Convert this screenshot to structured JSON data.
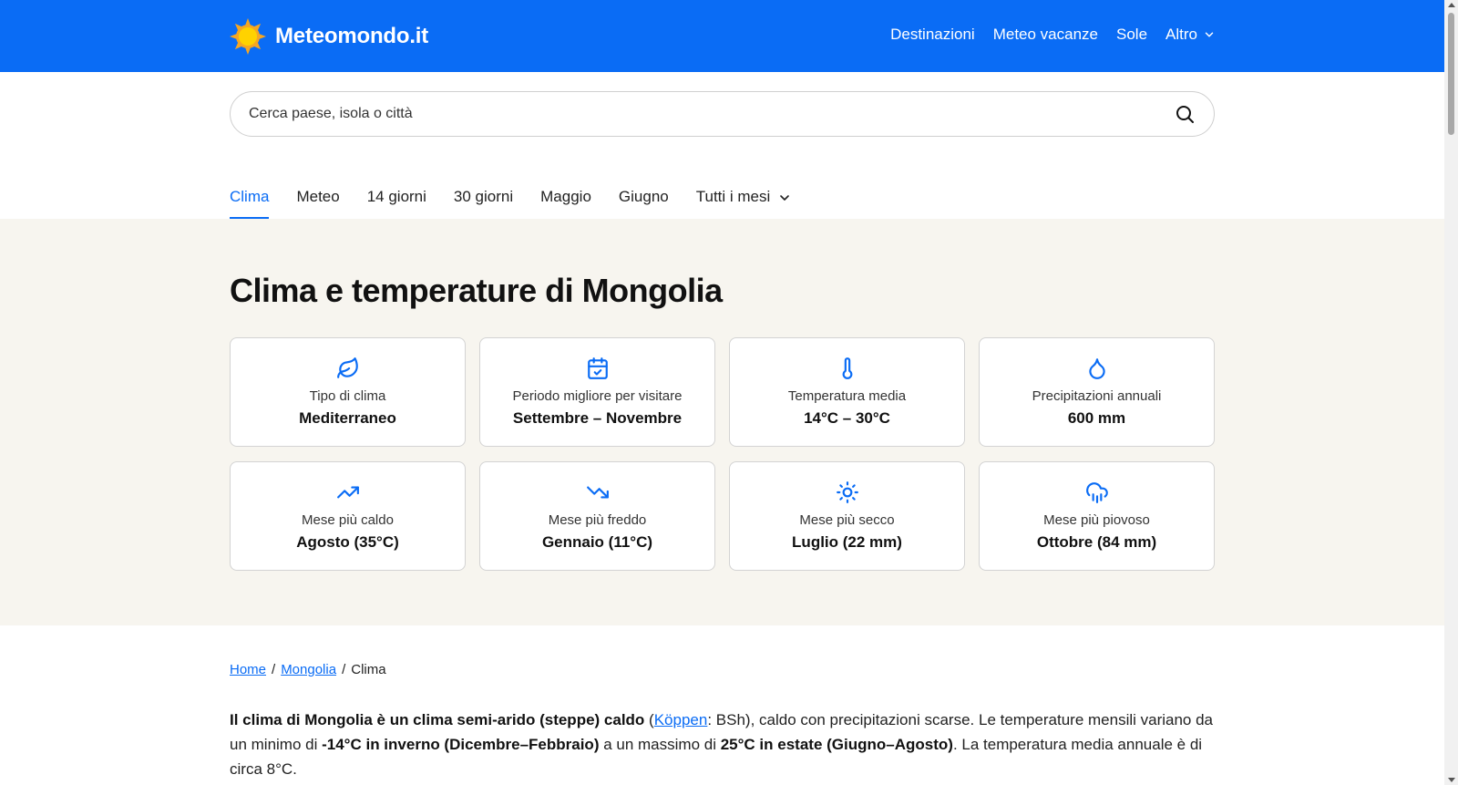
{
  "header": {
    "brand": "Meteomondo.it",
    "nav": [
      {
        "label": "Destinazioni"
      },
      {
        "label": "Meteo vacanze"
      },
      {
        "label": "Sole"
      },
      {
        "label": "Altro"
      }
    ]
  },
  "search": {
    "placeholder": "Cerca paese, isola o città"
  },
  "tabs": [
    {
      "label": "Clima"
    },
    {
      "label": "Meteo"
    },
    {
      "label": "14 giorni"
    },
    {
      "label": "30 giorni"
    },
    {
      "label": "Maggio"
    },
    {
      "label": "Giugno"
    },
    {
      "label": "Tutti i mesi"
    }
  ],
  "climate": {
    "title": "Clima e temperature di Mongolia",
    "cards": [
      {
        "icon": "leaf-icon",
        "label": "Tipo di clima",
        "value": "Mediterraneo"
      },
      {
        "icon": "calendar-check-icon",
        "label": "Periodo migliore per visitare",
        "value": "Settembre – Novembre"
      },
      {
        "icon": "thermometer-icon",
        "label": "Temperatura media",
        "value": "14°C – 30°C"
      },
      {
        "icon": "droplet-icon",
        "label": "Precipitazioni annuali",
        "value": "600 mm"
      },
      {
        "icon": "trending-up-icon",
        "label": "Mese più caldo",
        "value": "Agosto (35°C)"
      },
      {
        "icon": "trending-down-icon",
        "label": "Mese più freddo",
        "value": "Gennaio (11°C)"
      },
      {
        "icon": "sun-icon",
        "label": "Mese più secco",
        "value": "Luglio (22 mm)"
      },
      {
        "icon": "cloud-rain-icon",
        "label": "Mese più piovoso",
        "value": "Ottobre (84 mm)"
      }
    ]
  },
  "breadcrumb": {
    "home": "Home",
    "country": "Mongolia",
    "current": "Clima",
    "sep": "/"
  },
  "intro": {
    "p1_bold": "Il clima di Mongolia è un clima semi-arido (steppe) caldo",
    "p2": " (",
    "koppen": "Köppen",
    "p3": ": BSh), caldo con precipitazioni scarse. Le temperature mensili variano da un minimo di ",
    "p4_bold": "-14°C in inverno (Dicembre–Febbraio)",
    "p5": " a un massimo di ",
    "p6_bold": "25°C in estate (Giugno–Agosto)",
    "p7": ". La temperatura media annuale è di circa 8°C."
  },
  "colors": {
    "brand_blue": "#0a6cf5",
    "section_bg": "#f7f5ef"
  }
}
